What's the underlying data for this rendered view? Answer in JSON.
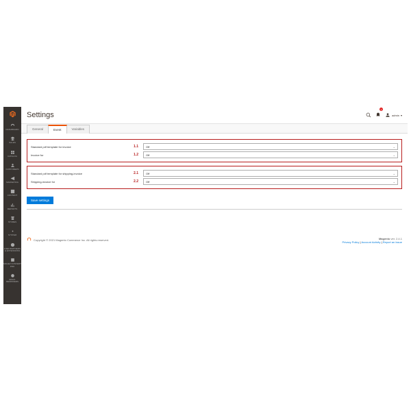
{
  "page_title": "Settings",
  "notifications_count": "1",
  "user": {
    "label": "admin"
  },
  "sidebar": {
    "items": [
      {
        "label": "DASHBOARD"
      },
      {
        "label": "SALES"
      },
      {
        "label": "CATALOG"
      },
      {
        "label": "CUSTOMERS"
      },
      {
        "label": "MARKETING"
      },
      {
        "label": "CONTENT"
      },
      {
        "label": "REPORTS"
      },
      {
        "label": "STORES"
      },
      {
        "label": "SYSTEM"
      },
      {
        "label": "FIND PARTNERS & EXTENSIONS"
      },
      {
        "label": "MAGE2 CONVERT PRO"
      },
      {
        "label": "EMAIL REMINDERS"
      }
    ]
  },
  "tabs": [
    {
      "label": "General",
      "active": false
    },
    {
      "label": "Event",
      "active": true
    },
    {
      "label": "Variables",
      "active": false
    }
  ],
  "group1": {
    "rows": [
      {
        "label": "Standard pdf template for invoice",
        "num": "1.1",
        "value": "Off"
      },
      {
        "label": "Invoice for",
        "num": "1.2",
        "value": "Off"
      }
    ]
  },
  "group2": {
    "rows": [
      {
        "label": "Standard pdf template for shipping-invoice",
        "num": "2.1",
        "value": "Off"
      },
      {
        "label": "Shipping-invoice for",
        "num": "2.2",
        "value": "Off"
      }
    ]
  },
  "save_label": "Save settings",
  "footer": {
    "copyright": "Copyright © 2021 Magento Commerce Inc. All rights reserved.",
    "version_label": "Magento",
    "version": "ver. 2.4.1",
    "links": [
      {
        "label": "Privacy Policy"
      },
      {
        "label": "Account Activity"
      },
      {
        "label": "Report an Issue"
      }
    ]
  }
}
